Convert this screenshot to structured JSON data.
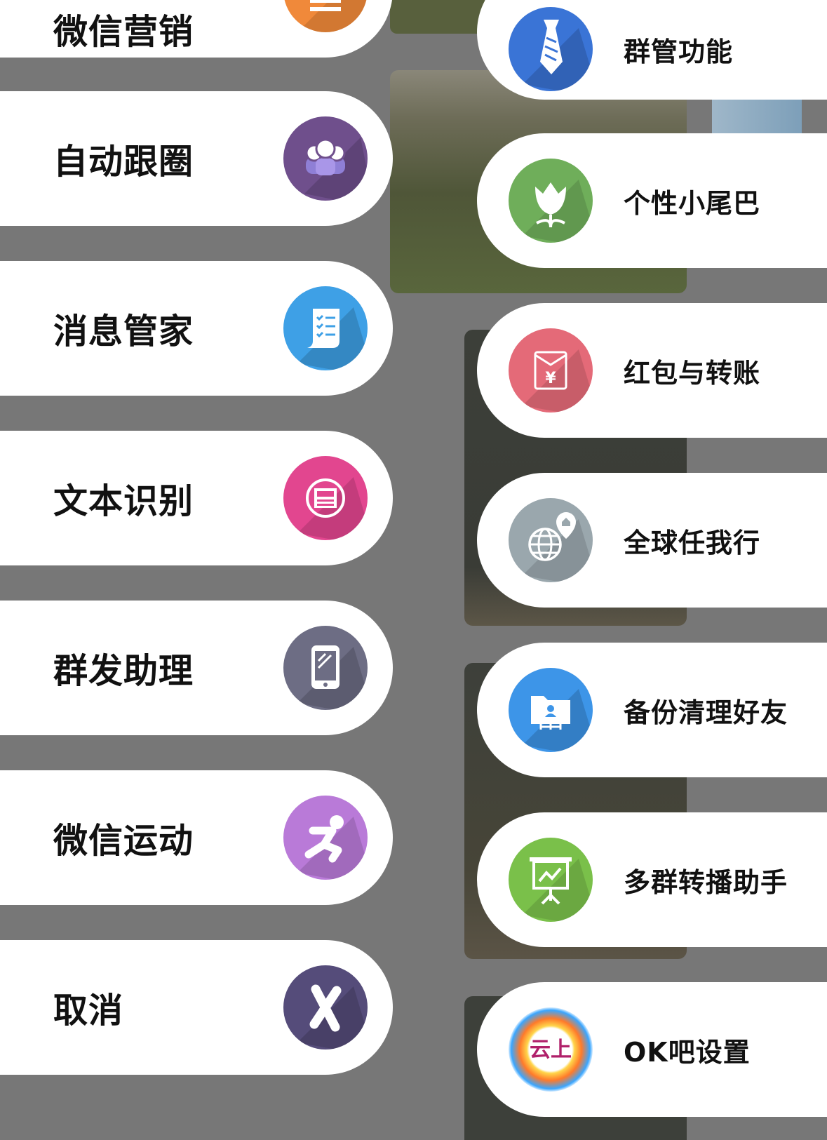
{
  "left_menu": [
    {
      "label": "微信营销",
      "icon": "scroll-icon",
      "color": "#f0893a"
    },
    {
      "label": "自动跟圈",
      "icon": "group-users-icon",
      "color": "#6f4f8c"
    },
    {
      "label": "消息管家",
      "icon": "checklist-icon",
      "color": "#3ea0e6"
    },
    {
      "label": "文本识别",
      "icon": "txt-scan-icon",
      "color": "#e2468f"
    },
    {
      "label": "群发助理",
      "icon": "tablet-icon",
      "color": "#6d6d84"
    },
    {
      "label": "微信运动",
      "icon": "running-man-icon",
      "color": "#b97ad8"
    },
    {
      "label": "取消",
      "icon": "close-x-icon",
      "color": "#554c7a"
    }
  ],
  "right_menu": [
    {
      "label": "群管功能",
      "icon": "necktie-icon",
      "color": "#3a74d6"
    },
    {
      "label": "个性小尾巴",
      "icon": "tulip-icon",
      "color": "#6fae5a"
    },
    {
      "label": "红包与转账",
      "icon": "red-envelope-icon",
      "color": "#e46a78"
    },
    {
      "label": "全球任我行",
      "icon": "globe-location-icon",
      "color": "#9aa7ad"
    },
    {
      "label": "备份清理好友",
      "icon": "contact-folder-icon",
      "color": "#3d95e8"
    },
    {
      "label": "多群转播助手",
      "icon": "presentation-board-icon",
      "color": "#7ac04a"
    },
    {
      "label": "OK吧设置",
      "icon": "yunshang-logo-icon",
      "logo_text": "云上"
    }
  ]
}
